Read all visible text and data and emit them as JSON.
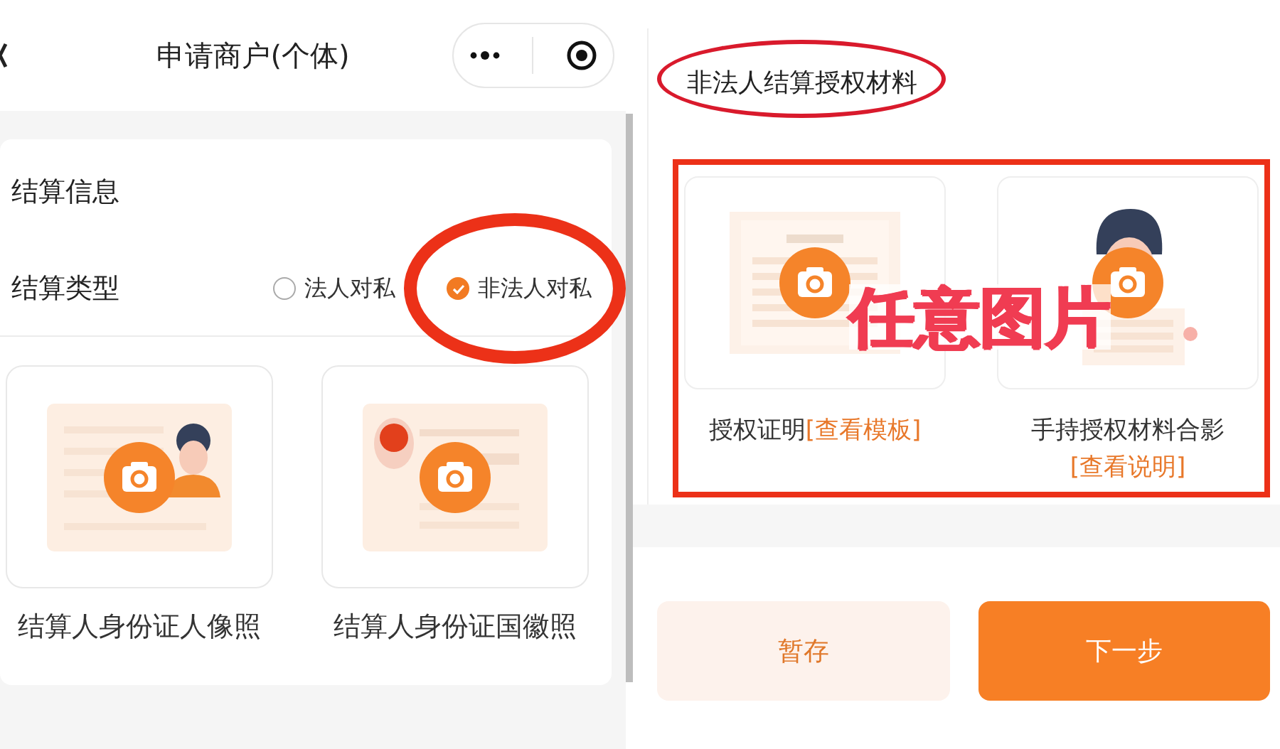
{
  "left_screen": {
    "nav_bar": {
      "title": "申请商户(个体)"
    },
    "section_title": "结算信息",
    "settlement_type": {
      "label": "结算类型",
      "options": [
        {
          "label": "法人对私",
          "selected": false
        },
        {
          "label": "非法人对私",
          "selected": true
        }
      ]
    },
    "upload_cards": [
      {
        "kind": "id-front",
        "caption": "结算人身份证人像照"
      },
      {
        "kind": "id-back",
        "caption": "结算人身份证国徽照"
      }
    ]
  },
  "right_screen": {
    "section_title": "非法人结算授权材料",
    "upload_cards": [
      {
        "kind": "document",
        "caption": "授权证明",
        "link": "[查看模板]"
      },
      {
        "kind": "holding",
        "caption": "手持授权材料合影",
        "link": "[查看说明]"
      }
    ],
    "buttons": [
      {
        "kind": "secondary",
        "label": "暂存"
      },
      {
        "kind": "primary",
        "label": "下一步"
      }
    ]
  },
  "annotations": [
    {
      "kind": "ellipse"
    },
    {
      "kind": "ellipse"
    },
    {
      "kind": "rectangle"
    },
    {
      "kind": "text",
      "text": "任意图片"
    }
  ]
}
